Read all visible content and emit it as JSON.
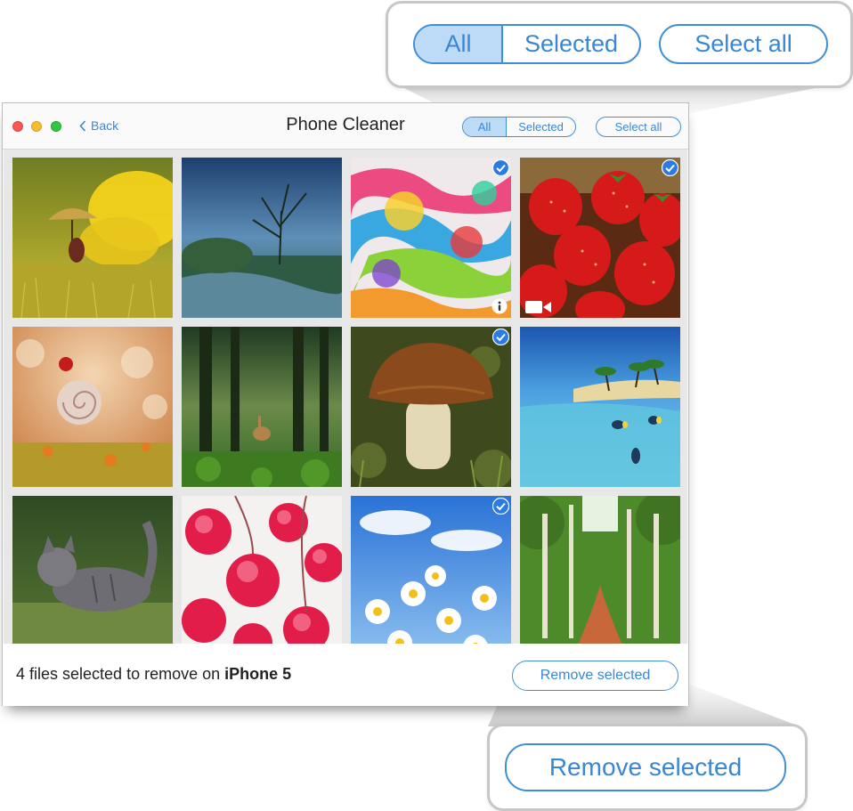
{
  "window": {
    "title": "Phone Cleaner",
    "back_label": "Back",
    "filter": {
      "all_label": "All",
      "selected_label": "Selected",
      "active": "All"
    },
    "select_all_label": "Select all"
  },
  "grid": {
    "photos": [
      {
        "subject": "girl with umbrella in meadow",
        "selected": false
      },
      {
        "subject": "tree by river",
        "selected": false
      },
      {
        "subject": "colorful paint splash",
        "selected": true,
        "badge": "info-icon"
      },
      {
        "subject": "strawberries",
        "selected": true,
        "badge": "video-icon"
      },
      {
        "subject": "ladybug on snail shell",
        "selected": false
      },
      {
        "subject": "deer in forest",
        "selected": false
      },
      {
        "subject": "mushroom",
        "selected": true
      },
      {
        "subject": "tropical sea and palms",
        "selected": false
      },
      {
        "subject": "kitten in grass",
        "selected": false
      },
      {
        "subject": "frosted red berries",
        "selected": false
      },
      {
        "subject": "daisies under blue sky",
        "selected": true
      },
      {
        "subject": "birch forest path",
        "selected": false
      }
    ]
  },
  "footer": {
    "status_prefix": "4 files selected to remove on",
    "device_name": "iPhone 5",
    "remove_label": "Remove selected"
  },
  "callouts": {
    "top": {
      "all_label": "All",
      "selected_label": "Selected",
      "select_all_label": "Select all"
    },
    "bottom": {
      "remove_label": "Remove selected"
    }
  },
  "colors": {
    "accent": "#3a86d6",
    "segment_active_bg": "#bddbf7",
    "check_badge": "#2a7be4"
  }
}
